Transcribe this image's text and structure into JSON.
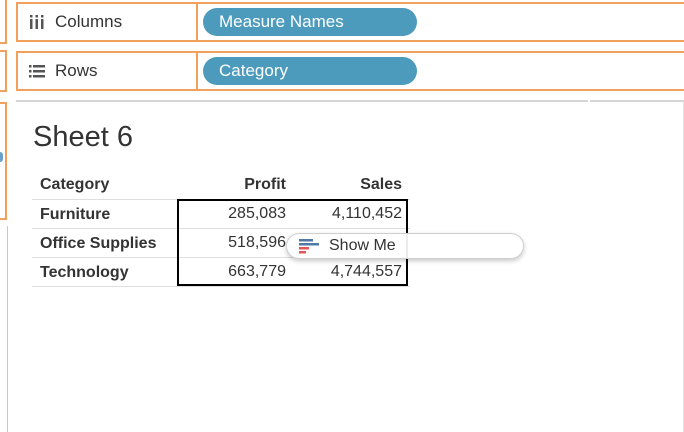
{
  "shelves": {
    "columns": {
      "label": "Columns",
      "icon": "columns-shelf-icon",
      "pill": "Measure Names"
    },
    "rows": {
      "label": "Rows",
      "icon": "rows-shelf-icon",
      "pill": "Category"
    }
  },
  "sheet": {
    "title": "Sheet 6"
  },
  "table": {
    "headers": {
      "category": "Category",
      "profit": "Profit",
      "sales": "Sales"
    },
    "rows": [
      {
        "category": "Furniture",
        "profit": "285,083",
        "sales": "4,110,452"
      },
      {
        "category": "Office Supplies",
        "profit": "518,596",
        "sales": ""
      },
      {
        "category": "Technology",
        "profit": "663,779",
        "sales": "4,744,557"
      }
    ]
  },
  "show_me": {
    "label": "Show Me",
    "icon": "show-me-icon"
  },
  "colors": {
    "pill": "#4c9bbd",
    "shelf_border": "#f2a15d",
    "selection": "#000000"
  }
}
